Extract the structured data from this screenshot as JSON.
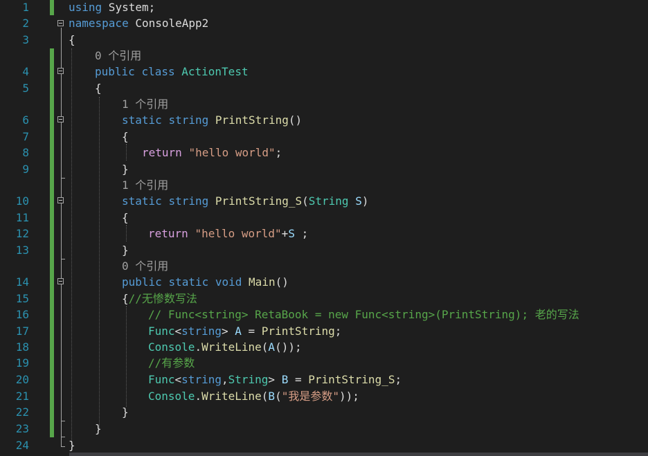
{
  "colors": {
    "background": "#1e1e1e",
    "line_number": "#2b91af",
    "keyword": "#569cd6",
    "type": "#4ec9b0",
    "method": "#dcdcaa",
    "string": "#d69d85",
    "comment": "#57a64a",
    "control_keyword": "#d8a0df",
    "variable": "#9cdcfe",
    "codelens": "#a0a0a0"
  },
  "line_numbers": [
    "1",
    "2",
    "3",
    "4",
    "5",
    "6",
    "7",
    "8",
    "9",
    "10",
    "11",
    "12",
    "13",
    "14",
    "15",
    "16",
    "17",
    "18",
    "19",
    "20",
    "21",
    "22",
    "23",
    "24"
  ],
  "codelens": {
    "class_refs": "0 个引用",
    "printstring_refs": "1 个引用",
    "printstring_s_refs": "1 个引用",
    "main_refs": "0 个引用"
  },
  "code": {
    "l1": [
      "using",
      " System;"
    ],
    "l2": [
      "namespace",
      " ConsoleApp2"
    ],
    "l3": [
      "{"
    ],
    "l4": [
      "public",
      " ",
      "class",
      " ",
      "ActionTest"
    ],
    "l5": [
      "{"
    ],
    "l6": [
      "static",
      " ",
      "string",
      " ",
      "PrintString",
      "()"
    ],
    "l7": [
      "{"
    ],
    "l8": [
      "return",
      " ",
      "\"hello world\"",
      ";"
    ],
    "l9": [
      "}"
    ],
    "l10": [
      "static",
      " ",
      "string",
      " ",
      "PrintString_S",
      "(",
      "String",
      " ",
      "S",
      ")"
    ],
    "l11": [
      "{"
    ],
    "l12": [
      "return",
      " ",
      "\"hello world\"",
      "+",
      "S",
      " ;"
    ],
    "l13": [
      "}"
    ],
    "l14": [
      "public",
      " ",
      "static",
      " ",
      "void",
      " ",
      "Main",
      "()"
    ],
    "l15": [
      "{",
      "//无惨数写法"
    ],
    "l16": [
      "// Func<string> RetaBook = new Func<string>(PrintString); 老的写法"
    ],
    "l17": [
      "Func",
      "<",
      "string",
      ">",
      " ",
      "A",
      " = ",
      "PrintString",
      ";"
    ],
    "l18": [
      "Console",
      ".",
      "WriteLine",
      "(",
      "A",
      "());"
    ],
    "l19": [
      "//有参数"
    ],
    "l20": [
      "Func",
      "<",
      "string",
      ",",
      "String",
      ">",
      " ",
      "B",
      " = ",
      "PrintString_S",
      ";"
    ],
    "l21": [
      "Console",
      ".",
      "WriteLine",
      "(",
      "B",
      "(",
      "\"我是参数\"",
      "));"
    ],
    "l22": [
      "}"
    ],
    "l23": [
      "}"
    ],
    "l24": [
      "}"
    ]
  }
}
